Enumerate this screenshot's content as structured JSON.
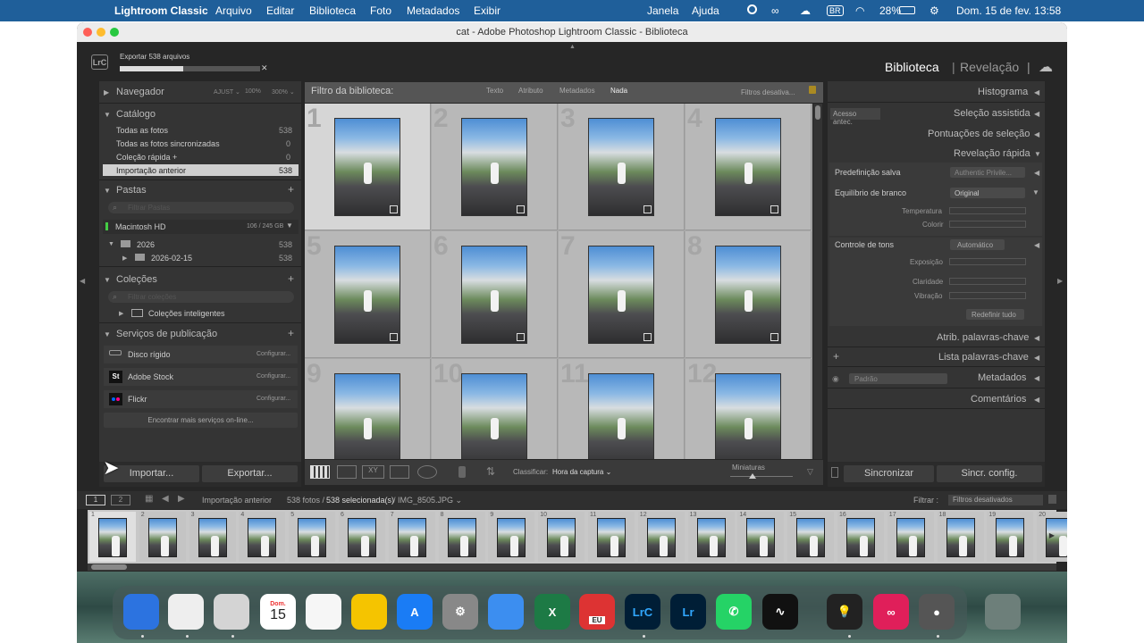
{
  "menubar": {
    "app": "Lightroom Classic",
    "items": [
      "Arquivo",
      "Editar",
      "Biblioteca",
      "Foto",
      "Metadados",
      "Exibir"
    ],
    "right_items": [
      "Janela",
      "Ajuda"
    ],
    "lang": "BR",
    "battery": "28%",
    "datetime": "Dom. 15 de fev.  13:58"
  },
  "window": {
    "title": "cat - Adobe Photoshop Lightroom Classic - Biblioteca"
  },
  "identity": {
    "logo": "LrC",
    "export_label": "Exportar 538 arquivos",
    "export_progress": 0.45,
    "modules": {
      "library": "Biblioteca",
      "develop": "Revelação"
    },
    "separator": "|"
  },
  "left": {
    "navigator": {
      "title": "Navegador",
      "zoom_opts": [
        "AJUST ⌄",
        "100%",
        "300% ⌄"
      ]
    },
    "catalog": {
      "title": "Catálogo",
      "rows": [
        {
          "label": "Todas as fotos",
          "count": "538"
        },
        {
          "label": "Todas as fotos sincronizadas",
          "count": "0"
        },
        {
          "label": "Coleção rápida +",
          "count": "0"
        },
        {
          "label": "Importação anterior",
          "count": "538"
        }
      ]
    },
    "folders": {
      "title": "Pastas",
      "search": "Filtrar Pastas",
      "volume": "Macintosh HD",
      "volume_size": "106 / 245 GB",
      "items": [
        {
          "label": "2026",
          "count": "538"
        },
        {
          "label": "2026-02-15",
          "count": "538"
        }
      ]
    },
    "collections": {
      "title": "Coleções",
      "search": "Filtrar coleções",
      "items": [
        "Coleções inteligentes"
      ]
    },
    "publish": {
      "title": "Serviços de publicação",
      "services": [
        {
          "label": "Disco rígido",
          "action": "Configurar..."
        },
        {
          "label": "Adobe Stock",
          "action": "Configurar...",
          "icon": "St"
        },
        {
          "label": "Flickr",
          "action": "Configurar..."
        }
      ],
      "find_more": "Encontrar mais serviços on-line..."
    },
    "import_btn": "Importar...",
    "export_btn": "Exportar..."
  },
  "filter": {
    "title": "Filtro da biblioteca:",
    "tabs": [
      "Texto",
      "Atributo",
      "Metadados",
      "Nada"
    ],
    "status": "Filtros desativa..."
  },
  "grid": {
    "cells": [
      "1",
      "2",
      "3",
      "4",
      "5",
      "6",
      "7",
      "8",
      "9",
      "10",
      "11",
      "12"
    ]
  },
  "toolbar": {
    "sort_label": "Classificar:",
    "sort_value": "Hora da captura ⌄",
    "thumbs_label": "Miniaturas",
    "thumb_level": 0.35
  },
  "right": {
    "histogram": "Histograma",
    "prev_import": "Acesso antec.",
    "assisted": "Seleção assistida",
    "scores": "Pontuações de seleção",
    "quick_develop": "Revelação rápida",
    "preset_label": "Predefinição salva",
    "preset_value": "Authentic Privile...",
    "wb_label": "Equilíbrio de branco",
    "wb_value": "Original",
    "temp": "Temperatura",
    "tint": "Colorir",
    "tone_label": "Controle de tons",
    "tone_value": "Automático",
    "exposure": "Exposição",
    "clarity": "Claridade",
    "vibrance": "Vibração",
    "reset": "Redefinir tudo",
    "keywording": "Atrib. palavras-chave",
    "keyword_list": "Lista palavras-chave",
    "metadata": "Metadados",
    "meta_preset": "Padrão",
    "comments": "Comentários",
    "sync": "Sincronizar",
    "sync_settings": "Sincr. config."
  },
  "filmstrip": {
    "page1": "1",
    "page2": "2",
    "source": "Importação anterior",
    "count": "538 fotos /",
    "selected": "538 selecionada(s)",
    "file": "/ IMG_8505.JPG ⌄",
    "filter_label": "Filtrar :",
    "filter_value": "Filtros desativados",
    "numbers": [
      "1",
      "2",
      "3",
      "4",
      "5",
      "6",
      "7",
      "8",
      "9",
      "10",
      "11",
      "12",
      "13",
      "14",
      "15",
      "16",
      "17",
      "18",
      "19",
      "20"
    ]
  },
  "dock": {
    "calendar_month": "Dom.",
    "calendar_day": "15",
    "acrobat": "EU",
    "lrc": "LrC",
    "lr": "Lr",
    "app_icons": [
      "finder",
      "chrome",
      "preview",
      "calendar",
      "reminders",
      "notes",
      "app-store",
      "settings",
      "iphone-mirroring",
      "excel",
      "acrobat",
      "lightroom-classic",
      "lightroom",
      "whatsapp",
      "activity-monitor",
      "bulb",
      "creative-cloud",
      "disk-utility",
      "trash"
    ]
  }
}
